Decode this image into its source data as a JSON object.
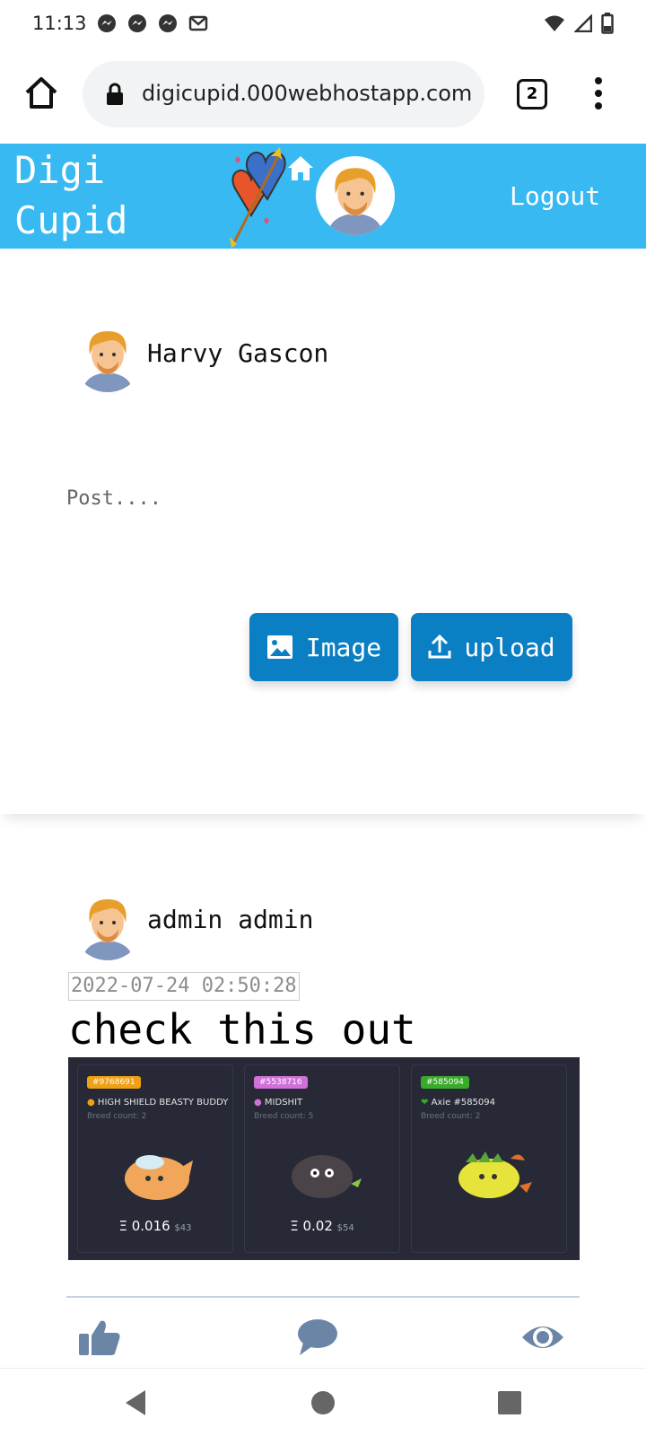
{
  "status_bar": {
    "time": "11:13"
  },
  "browser": {
    "url": "digicupid.000webhostapp.com",
    "tab_count": "2"
  },
  "header": {
    "brand_line1": "Digi",
    "brand_line2": "Cupid",
    "logout": "Logout"
  },
  "composer": {
    "user_name": "Harvy Gascon",
    "placeholder": "Post....",
    "image_button": "Image",
    "upload_button": "upload"
  },
  "post": {
    "author": "admin admin",
    "timestamp": "2022-07-24 02:50:28",
    "text": "check this out",
    "image": {
      "cards": [
        {
          "id": "#9768691",
          "id_color": "#f0a014",
          "name": "HIGH SHIELD BEASTY BUDDY",
          "breed": "Breed count: 2",
          "price": "Ξ 0.016",
          "usd": "$43"
        },
        {
          "id": "#5538716",
          "id_color": "#d070d8",
          "name": "MIDSHIT",
          "breed": "Breed count: 5",
          "price": "Ξ 0.02",
          "usd": "$54"
        },
        {
          "id": "#585094",
          "id_color": "#3aaa2a",
          "name": "Axie #585094",
          "breed": "Breed count: 2",
          "price": "",
          "usd": ""
        }
      ]
    }
  },
  "colors": {
    "header_bg": "#39b9f2",
    "button_bg": "#0a7fc4",
    "action_icons": "#6b85a6"
  }
}
